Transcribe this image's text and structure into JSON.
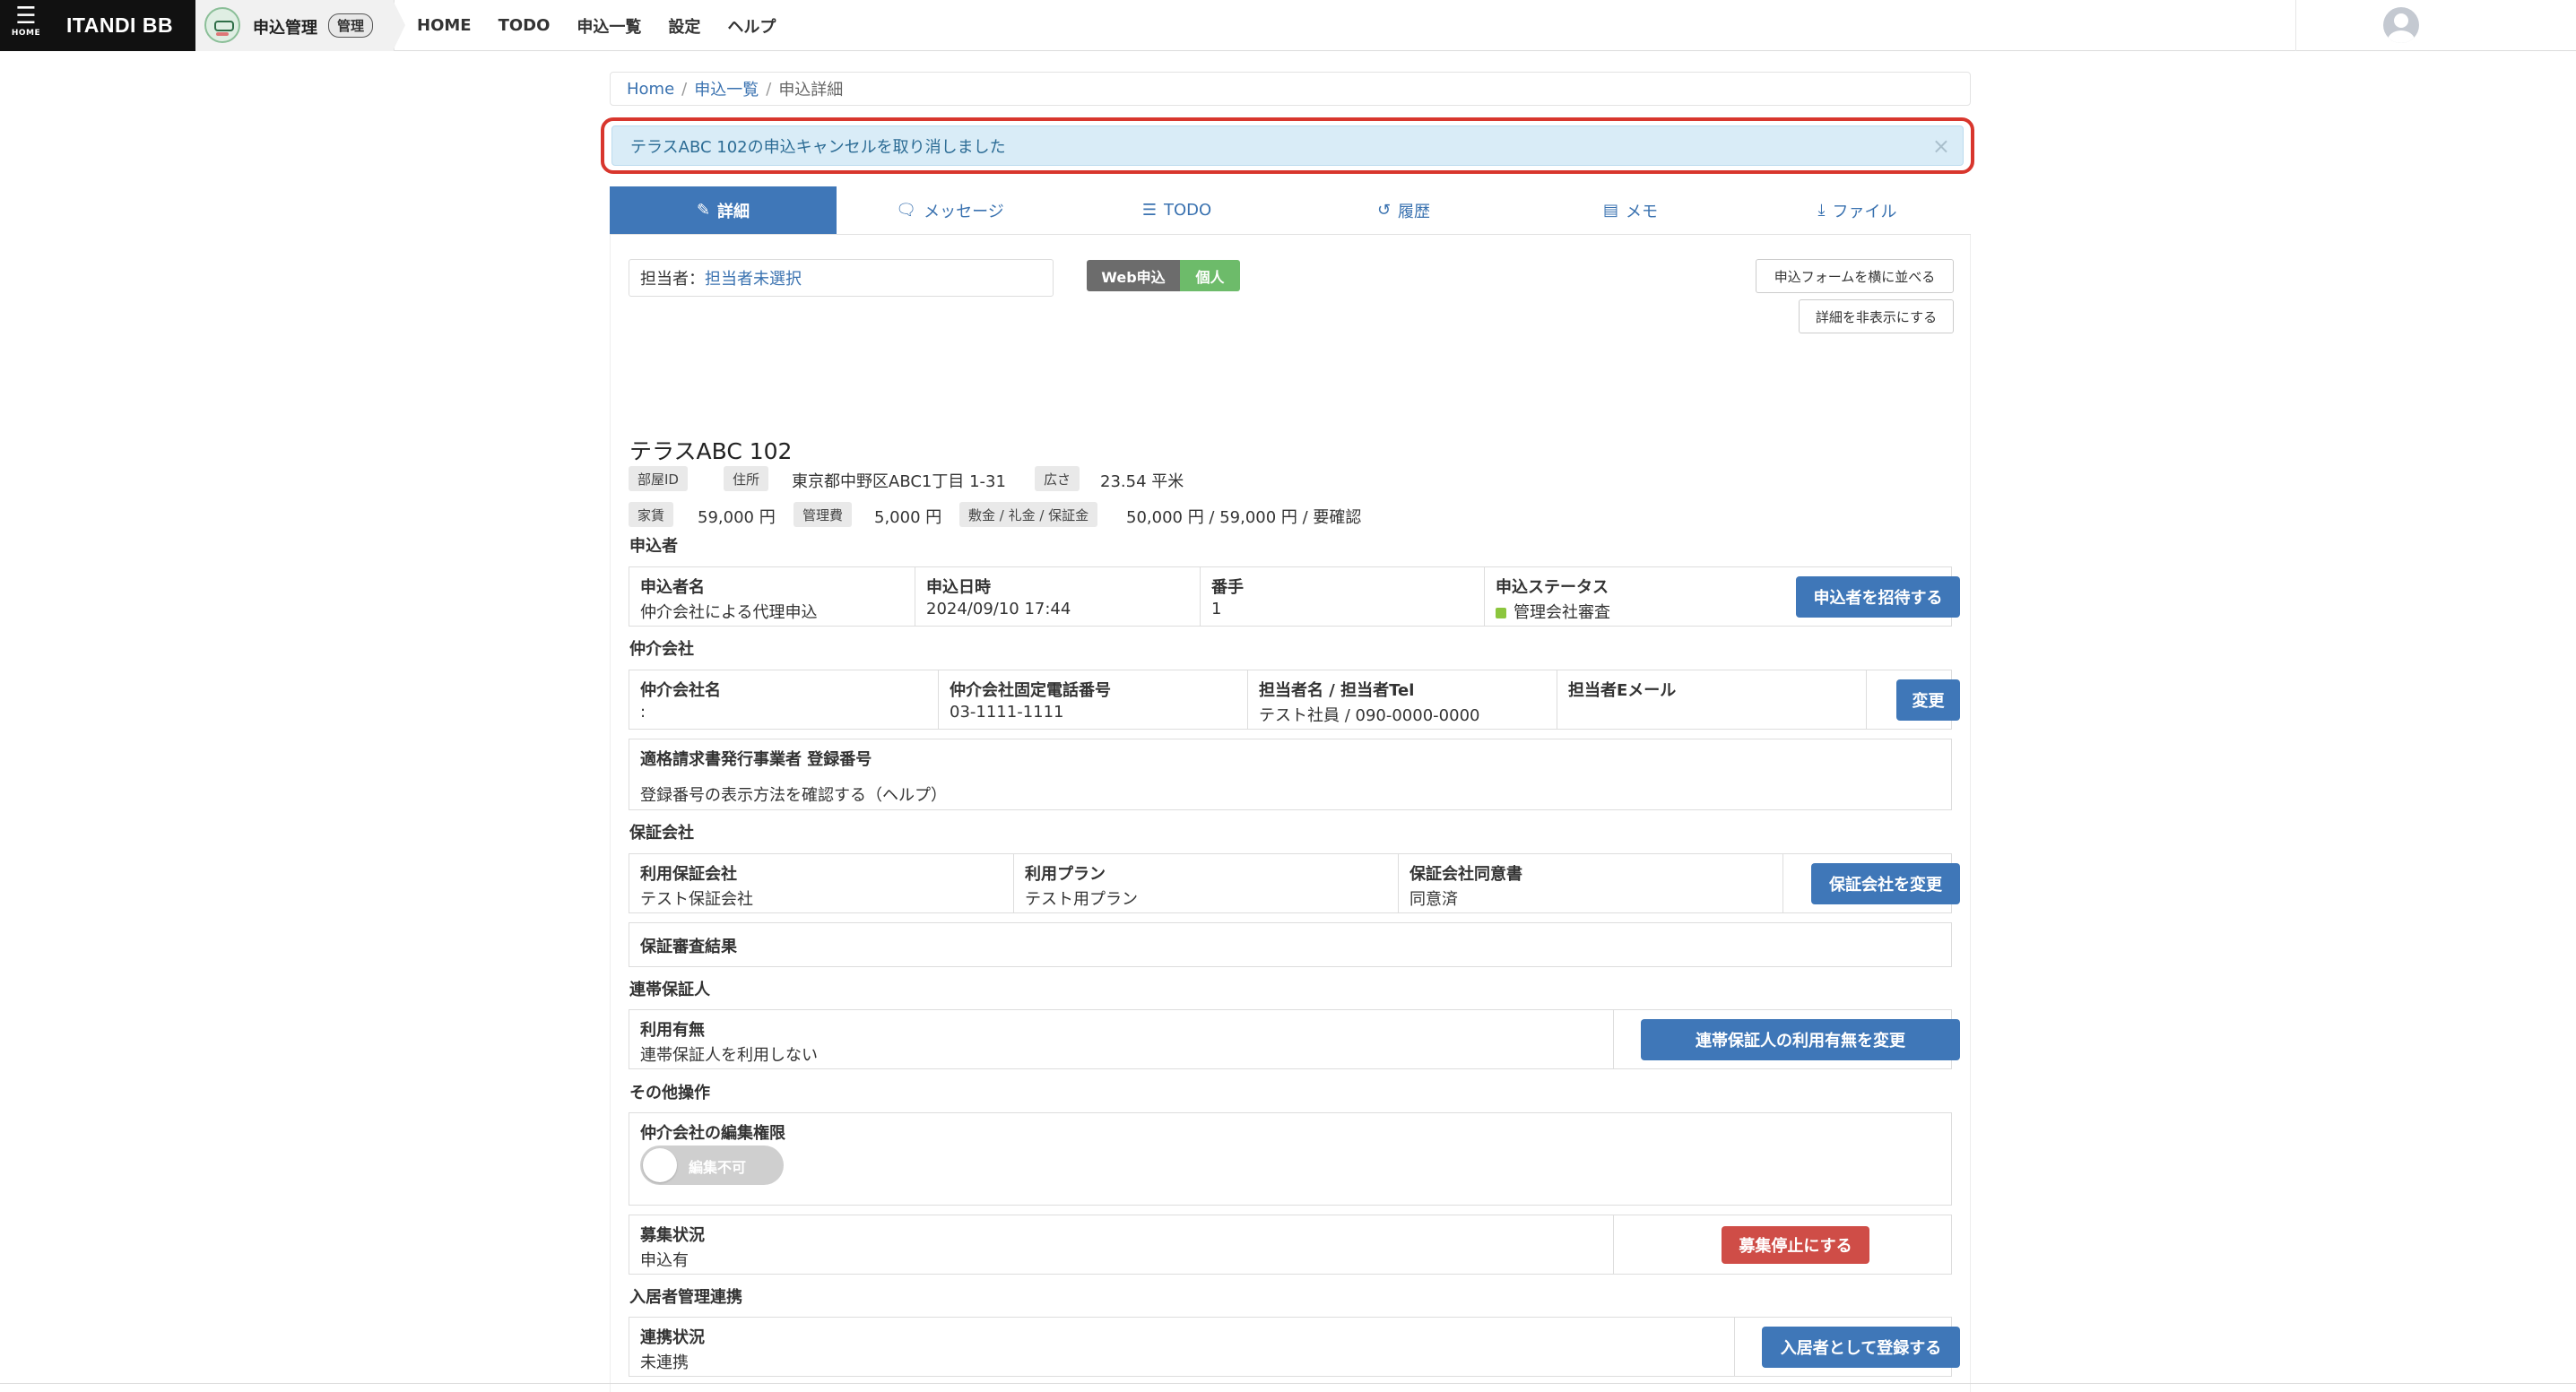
{
  "topbar": {
    "home_label": "HOME",
    "brand": "ITANDI BB",
    "app_name": "申込管理",
    "app_badge": "管理",
    "nav": [
      "HOME",
      "TODO",
      "申込一覧",
      "設定",
      "ヘルプ"
    ]
  },
  "breadcrumb": {
    "home": "Home",
    "list": "申込一覧",
    "current": "申込詳細"
  },
  "alert": {
    "message": "テラスABC 102の申込キャンセルを取り消しました",
    "close": "×"
  },
  "tabs": [
    {
      "label": "詳細",
      "icon": "✎"
    },
    {
      "label": "メッセージ",
      "icon": "🗨"
    },
    {
      "label": "TODO",
      "icon": "☰"
    },
    {
      "label": "履歴",
      "icon": "↺"
    },
    {
      "label": "メモ",
      "icon": "▤"
    },
    {
      "label": "ファイル",
      "icon": "⤓"
    }
  ],
  "header": {
    "assignee_label": "担当者：",
    "assignee_value": "担当者未選択",
    "tag_web": "Web申込",
    "tag_kojin": "個人",
    "btn_side_by_side": "申込フォームを横に並べる",
    "btn_hide_detail": "詳細を非表示にする"
  },
  "property": {
    "title": "テラスABC 102",
    "room_id_label": "部屋ID",
    "address_label": "住所",
    "address": "東京都中野区ABC1丁目 1-31",
    "area_label": "広さ",
    "area": "23.54 平米",
    "rent_label": "家賃",
    "rent": "59,000 円",
    "mgmt_label": "管理費",
    "mgmt": "5,000 円",
    "deposit_label": "敷金 / 礼金 / 保証金",
    "deposit": "50,000 円 / 59,000 円 / 要確認"
  },
  "applicant": {
    "section": "申込者",
    "name_h": "申込者名",
    "name_v": "仲介会社による代理申込",
    "date_h": "申込日時",
    "date_v": "2024/09/10 17:44",
    "num_h": "番手",
    "num_v": "1",
    "status_h": "申込ステータス",
    "status_v": "管理会社審査",
    "invite_btn": "申込者を招待する"
  },
  "broker": {
    "section": "仲介会社",
    "name_h": "仲介会社名",
    "name_v": ":",
    "tel_h": "仲介会社固定電話番号",
    "tel_v": "03-1111-1111",
    "staff_h": "担当者名 / 担当者Tel",
    "staff_v": "テスト社員 / 090-0000-0000",
    "email_h": "担当者Eメール",
    "change_btn": "変更",
    "invoice_h": "適格請求書発行事業者 登録番号",
    "invoice_link": "登録番号の表示方法を確認する（ヘルプ）"
  },
  "guarantor": {
    "section": "保証会社",
    "company_h": "利用保証会社",
    "company_v": "テスト保証会社",
    "plan_h": "利用プラン",
    "plan_v": "テスト用プラン",
    "consent_h": "保証会社同意書",
    "consent_v": "同意済",
    "change_btn": "保証会社を変更",
    "result_h": "保証審査結果"
  },
  "joint": {
    "section": "連帯保証人",
    "use_h": "利用有無",
    "use_v": "連帯保証人を利用しない",
    "change_btn": "連帯保証人の利用有無を変更"
  },
  "other": {
    "section": "その他操作",
    "edit_h": "仲介会社の編集権限",
    "toggle_label": "編集不可",
    "recruit_h": "募集状況",
    "recruit_v": "申込有",
    "stop_btn": "募集停止にする"
  },
  "resident": {
    "section": "入居者管理連携",
    "link_h": "連携状況",
    "link_v": "未連携",
    "register_btn": "入居者として登録する"
  }
}
